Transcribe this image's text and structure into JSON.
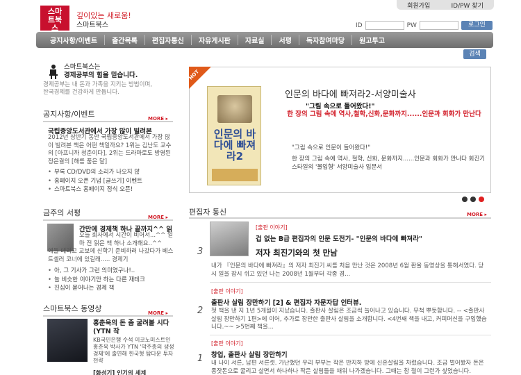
{
  "header": {
    "logo_line1": "스마",
    "logo_line2": "트북",
    "logo_line3": "스",
    "slogan": "깊이있는 새로움!",
    "brand": "스마트북스",
    "top_links": [
      "회원가입",
      "ID/PW 찾기"
    ],
    "login": {
      "id_label": "ID",
      "pw_label": "PW",
      "button": "로그인"
    }
  },
  "nav": [
    "공지사항/이벤트",
    "출간목록",
    "편집자통신",
    "자유게시판",
    "자료실",
    "서평",
    "독자참여마당",
    "원고투고"
  ],
  "search_button": "검색",
  "intro": {
    "headline_1": "스마트북스는",
    "headline_2": "경제공부의 힘을 믿습니다.",
    "sub_1": "경제공부는 내 돈과 가족을 지키는 방법이며,",
    "sub_2": "한국경제를 건강하게 만듭니다."
  },
  "notice": {
    "title": "공지사항/이벤트",
    "more": "MORE ▸",
    "headline": "국립중앙도서관에서 가장 많이 빌려본",
    "body": "2012년 상반기 동안 국립중앙도서관에서 가장 많이 빌려본 책은 어떤 책일까요? 1위는 김난도 교수의 [아프니까 청춘이다], 2위는 드라마로도 방영된 정은궐의 [해를 품은 달]",
    "items": [
      "부록 CD/DVD의 소리가 나오지 않",
      "홈페이지 오픈 기념 [글쓰기] 이벤트",
      "스마트북스 홈페이지 정식 오픈!"
    ]
  },
  "best": {
    "title": "금주의 서평",
    "more": "MORE ▸",
    "headline": "간만에 경제책 하나 끝까지^^ 읽",
    "body": "오늘 회사에서 시간이 비어서...^^ 얼마 전 읽은 책 하나 소개해요..^^",
    "body2": "애들 데리고 교보에 신학기 준비하러 나갔다가 베스트셀러 코너에 있길래..... 경제기",
    "items": [
      "아, 그 기사가 그런 의미였구나!..",
      "늘 비슷한 이야기만 하는 다른 재테크",
      "진심이 묻어나는 경제 책"
    ]
  },
  "video": {
    "title": "스마트북스 동영상",
    "more": "MORE ▸",
    "headline": "홍춘욱의 돈 좀 굴려볼 시다(YTN 작",
    "body": "KB국민은행 수석 이코노미스트인 홍춘욱 박사가 YTN '막주총의 생생경제'에 출연해 한국형 탐다운 투자전략",
    "next": "[화성기] 인기의 세계"
  },
  "hero": {
    "hot": "HOT",
    "book_title": "인문의 바다에 빠져라2",
    "title": "인문의 바다에 빠져라2-서양미술사",
    "subtitle": "\"그림 속으로 들어왔다!\"",
    "red": "한 장의 그림 속에 역사,철학,신화,문화까지......인문과 회화가 만난다",
    "quote": "\"그림 속으로 인문이 들어왔다!\"",
    "desc": "한 장의 그림 속에 역사, 철학, 신화, 문화까지......인문과 회화가 만나다 회진기 스타일의 '몰입형' 서양미술사 입문서"
  },
  "news": {
    "title": "편집자 통신",
    "more": "MORE ▸",
    "items": [
      {
        "num": "3",
        "cat": "[출판 이야기]",
        "title": "겁 없는 B급 편집자의 인문 도전기- \"인문의 바다에 빠져라\"",
        "subtitle": "저자 최진기와의 첫 만남",
        "body": "내가 『인문의 바다에 빠져라』의 저자 최진기 씨를 처음 만난 것은 2008년 6월 환율 동영상을 통해서였다. 당시 일을 잠시 쉬고 있던 나는 2008년 1월부터 각종 경..."
      },
      {
        "num": "2",
        "cat": "[출판 이야기]",
        "title": "출판사 살림 장만하기 [2] & 편집자 자문자답 인터뷰.",
        "body": "첫 책을 낸 지 1년 5개월이 지났습니다. 출판사 살림은 조금씩 늘어나고 있습니다. 무척 뿌듯합니다. -- <출판사 살림 장만하기 1편>에 이어, 추가로 장만한 출판사 살림을 소개합니다. <4번째 책을 내고, 커피머신을 구입했습니다.~~ >5번째 책을..."
      },
      {
        "num": "1",
        "cat": "[출판 이야기]",
        "title": "창업, 출판사 살림 장만하기",
        "body": "내 나이 서른, 남편 서른셋. 가난했던 우리 부부는 작은 반지하 방에 신혼살림을 차렸습니다. 조금 벌어봤자 돈은 종잣돈으로 굴리고 살면서 하나하나 작은 살림들을 채워 나가겠습니다. 그때는 참 철이 그런가 싶었습니다."
      }
    ]
  },
  "colors": {
    "accent_red": "#d21f2a",
    "logo_red": "#c8102e",
    "nav_gray": "#7d7d7d",
    "button_blue": "#5b83b5",
    "hot_orange": "#e05a1a"
  }
}
